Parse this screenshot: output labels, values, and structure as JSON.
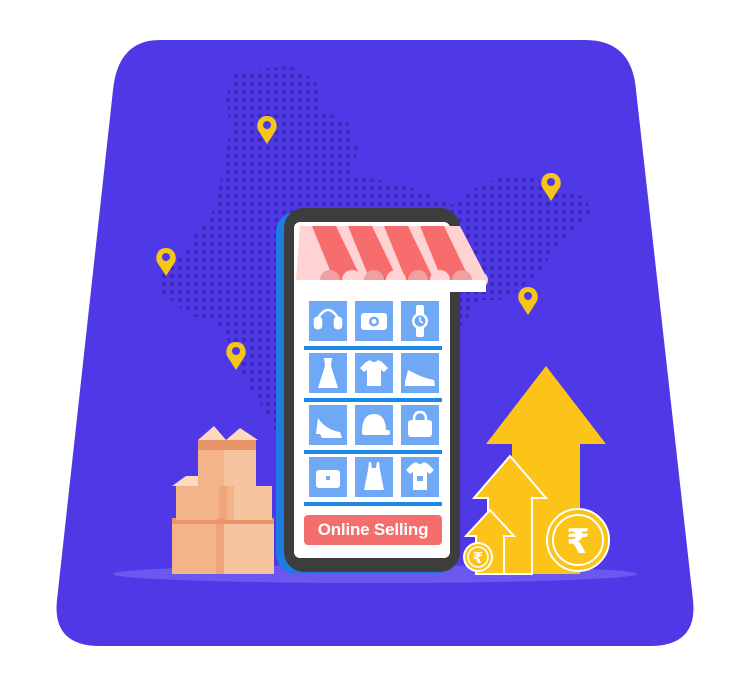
{
  "illustration": {
    "button_label": "Online Selling",
    "currency_symbol": "₹",
    "colors": {
      "background_panel": "#4f39e6",
      "map_dots": "#3a2ab8",
      "pin": "#f5c518",
      "arrow": "#fcc419",
      "phone_frame": "#3d3d3d",
      "phone_screen": "#ffffff",
      "phone_edge": "#1e7be0",
      "tile": "#6fa8f5",
      "shelf": "#1e88e5",
      "awning_red": "#f76c6c",
      "awning_light": "#ffd3d3",
      "box": "#f4b48a",
      "box_dark": "#e8956a",
      "button": "#f46e6e"
    },
    "product_icons": [
      "headphones-icon",
      "camera-icon",
      "watch-icon",
      "dress-icon",
      "tshirt-icon",
      "shoe-icon",
      "heel-icon",
      "cap-icon",
      "bag-icon",
      "purse-icon",
      "top-icon",
      "shirt-icon"
    ]
  }
}
